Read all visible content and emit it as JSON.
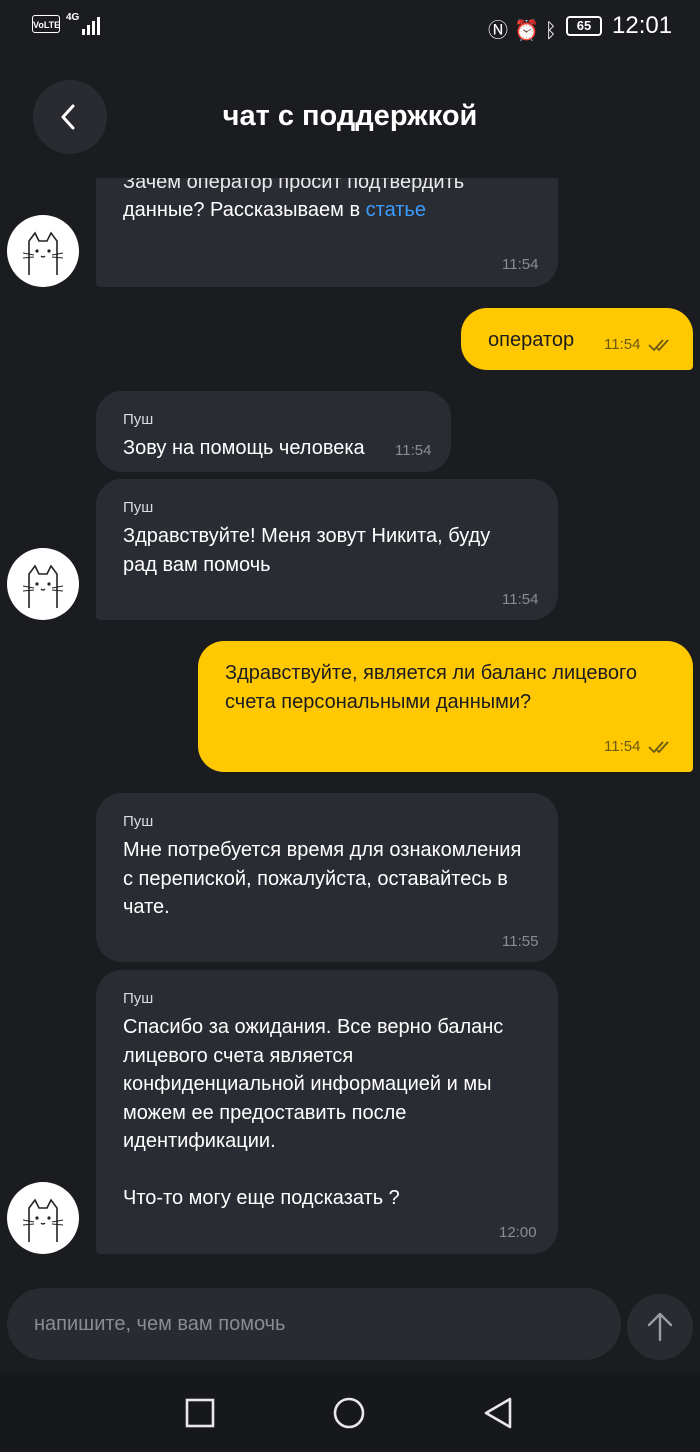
{
  "status_bar": {
    "volte": "VoLTE",
    "network": "4G",
    "battery": "65",
    "time": "12:01"
  },
  "header": {
    "title": "чат с поддержкой"
  },
  "messages": [
    {
      "direction": "incoming",
      "text_partial_top": "Зачем оператор просит подтвердить",
      "text": "данные? Рассказываем в ",
      "link": "статье",
      "time": "11:54"
    },
    {
      "direction": "outgoing",
      "text": "оператор",
      "time": "11:54"
    },
    {
      "direction": "incoming",
      "sender": "Пуш",
      "text": "Зову на помощь человека",
      "time": "11:54"
    },
    {
      "direction": "incoming",
      "sender": "Пуш",
      "text": "Здравствуйте! Меня зовут Никита, буду\nрад вам помочь",
      "time": "11:54"
    },
    {
      "direction": "outgoing",
      "text": "Здравствуйте, является ли баланс лицевого\nсчета персональными данными?",
      "time": "11:54"
    },
    {
      "direction": "incoming",
      "sender": "Пуш",
      "text": "Мне потребуется время для ознакомления\nс перепиской, пожалуйста, оставайтесь в\nчате.",
      "time": "11:55"
    },
    {
      "direction": "incoming",
      "sender": "Пуш",
      "text": "Спасибо за ожидания. Все верно баланс\nлицевого счета является\nконфиденциальной информацией и мы\nможем ее предоставить после\nидентификации.\n\nЧто-то могу еще подсказать ?",
      "time": "12:00"
    }
  ],
  "composer": {
    "placeholder": "напишите, чем вам помочь"
  },
  "icons": {
    "back": "chevron-left-icon",
    "send": "arrow-up-icon",
    "read_status": "double-check-icon",
    "avatar": "cat-avatar-icon",
    "nav_recents": "square-icon",
    "nav_home": "circle-icon",
    "nav_back": "triangle-back-icon"
  },
  "colors": {
    "background": "#1b1c20",
    "incoming_bubble": "#2a2c33",
    "outgoing_bubble": "#ffc800",
    "link": "#3b9cff"
  }
}
